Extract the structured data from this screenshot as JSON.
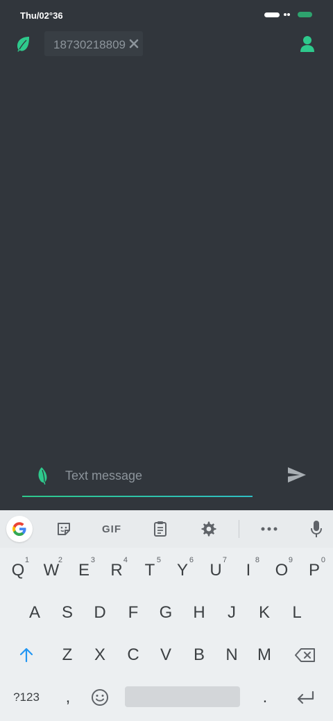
{
  "status_bar": {
    "time": "Thu/02°36"
  },
  "header": {
    "recipient": "18730218809",
    "logo_icon": "leaf-icon",
    "contact_icon": "person-icon",
    "accent_color": "#2ec98c"
  },
  "compose": {
    "placeholder": "Text message",
    "send_icon": "send-icon"
  },
  "keyboard": {
    "toolbar": {
      "gif_label": "GIF",
      "icons": [
        "google-icon",
        "sticker-icon",
        "gif-icon",
        "clipboard-icon",
        "gear-icon",
        "more-icon",
        "mic-icon"
      ]
    },
    "row1": [
      {
        "key": "Q",
        "hint": "1"
      },
      {
        "key": "W",
        "hint": "2"
      },
      {
        "key": "E",
        "hint": "3"
      },
      {
        "key": "R",
        "hint": "4"
      },
      {
        "key": "T",
        "hint": "5"
      },
      {
        "key": "Y",
        "hint": "6"
      },
      {
        "key": "U",
        "hint": "7"
      },
      {
        "key": "I",
        "hint": "8"
      },
      {
        "key": "O",
        "hint": "9"
      },
      {
        "key": "P",
        "hint": "0"
      }
    ],
    "row2": [
      "A",
      "S",
      "D",
      "F",
      "G",
      "H",
      "J",
      "K",
      "L"
    ],
    "row3": [
      "Z",
      "X",
      "C",
      "V",
      "B",
      "N",
      "M"
    ],
    "row4": {
      "symbols": "?123",
      "comma": ",",
      "period": "."
    }
  }
}
